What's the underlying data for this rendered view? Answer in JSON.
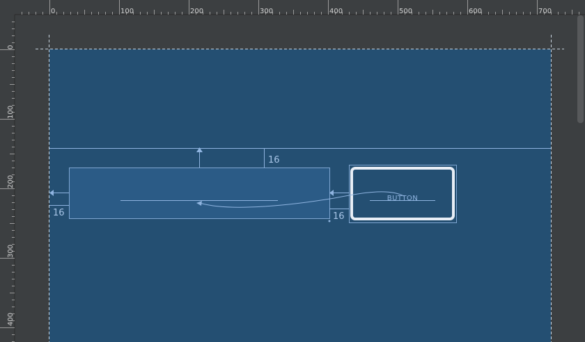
{
  "ruler": {
    "top_labels": [
      "0",
      "100",
      "200",
      "300",
      "400",
      "500",
      "600",
      "700"
    ],
    "left_labels": [
      "0",
      "100",
      "200",
      "300",
      "400"
    ]
  },
  "constraints": {
    "margin_top": "16",
    "margin_left": "16",
    "margin_button": "16"
  },
  "button": {
    "label": "BUTTON"
  },
  "colors": {
    "canvas": "#244f72",
    "ruler_bg": "#3c3f41",
    "blueprint_line": "#8fb4e0",
    "button_border": "#e8eef6"
  }
}
